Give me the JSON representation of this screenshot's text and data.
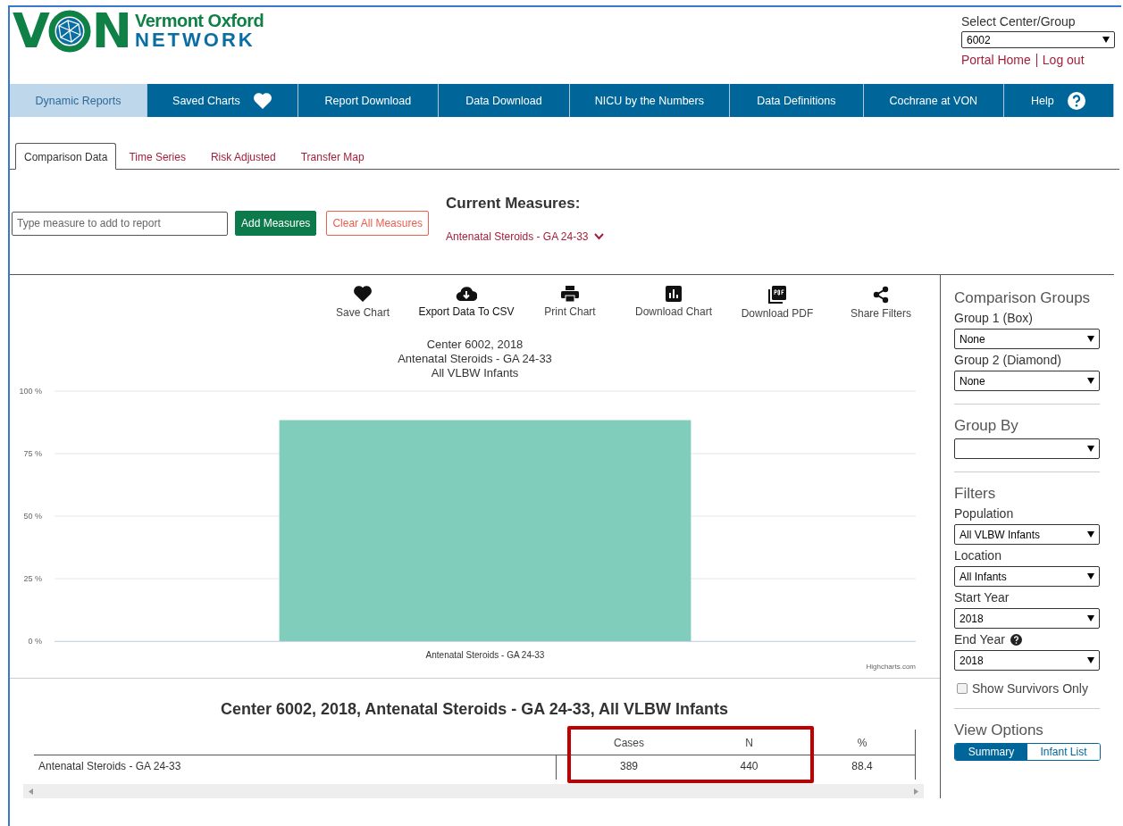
{
  "logo": {
    "letters_left": "V",
    "letters_right": "N",
    "line1": "Vermont Oxford",
    "line2": "NETWORK"
  },
  "center_select": {
    "label": "Select Center/Group",
    "value": "6002"
  },
  "header_links": [
    "Portal Home",
    "Log out"
  ],
  "nav": [
    {
      "label": "Dynamic Reports",
      "selected": true,
      "kind": "text"
    },
    {
      "label": "Saved Charts",
      "selected": false,
      "kind": "heart"
    },
    {
      "label": "Report Download",
      "selected": false,
      "kind": "text"
    },
    {
      "label": "Data Download",
      "selected": false,
      "kind": "text"
    },
    {
      "label": "NICU by the Numbers",
      "selected": false,
      "kind": "text"
    },
    {
      "label": "Data Definitions",
      "selected": false,
      "kind": "text"
    },
    {
      "label": "Cochrane at VON",
      "selected": false,
      "kind": "text"
    },
    {
      "label": "Help",
      "selected": false,
      "kind": "help"
    }
  ],
  "tabs": [
    {
      "label": "Comparison Data",
      "selected": true
    },
    {
      "label": "Time Series",
      "selected": false
    },
    {
      "label": "Risk Adjusted",
      "selected": false
    },
    {
      "label": "Transfer Map",
      "selected": false
    }
  ],
  "measure_search": {
    "placeholder": "Type measure to add to report"
  },
  "buttons": [
    {
      "label": "Add Measures",
      "kind": "primary"
    },
    {
      "label": "Clear All Measures",
      "kind": "danger"
    }
  ],
  "current_measures": {
    "heading": "Current Measures:",
    "items": [
      "Antenatal Steroids - GA 24-33"
    ]
  },
  "toolbar": [
    {
      "label": "Save Chart",
      "kind": "heart"
    },
    {
      "label": "Export Data To CSV",
      "kind": "cloud"
    },
    {
      "label": "Print Chart",
      "kind": "print"
    },
    {
      "label": "Download Chart",
      "kind": "chart"
    },
    {
      "label": "Download PDF",
      "kind": "pdf"
    },
    {
      "label": "Share Filters",
      "kind": "share"
    }
  ],
  "chart": {
    "credits": "Highcharts.com",
    "chart_data": {
      "type": "bar",
      "title": "Center 6002, 2018\nAntenatal Steroids - GA 24-33\nAll VLBW Infants",
      "categories": [
        "Antenatal Steroids - GA 24-33"
      ],
      "series": [
        {
          "color": "#80cdbc",
          "values": [
            88.4
          ]
        }
      ],
      "ylim": [
        0,
        100
      ],
      "grid": true,
      "yticks": [
        {
          "value": 0,
          "label": "0 %"
        },
        {
          "value": 25,
          "label": "25 %"
        },
        {
          "value": 50,
          "label": "50 %"
        },
        {
          "value": 75,
          "label": "75 %"
        },
        {
          "value": 100,
          "label": "100 %"
        }
      ]
    }
  },
  "table": {
    "title": "Center 6002, 2018, Antenatal Steroids - GA 24-33, All VLBW Infants",
    "columns": [
      {
        "label": "Cases",
        "highlighted": true
      },
      {
        "label": "N",
        "highlighted": true
      },
      {
        "label": "%",
        "highlighted": false
      }
    ],
    "rows": [
      {
        "label": "Antenatal Steroids - GA 24-33",
        "cells": [
          "389",
          "440",
          "88.4"
        ]
      }
    ]
  },
  "sidebar": {
    "sections": [
      {
        "heading": "Comparison Groups",
        "fields": [
          {
            "label": "Group 1 (Box)",
            "value": "None",
            "kind": "dropdown"
          },
          {
            "label": "Group 2 (Diamond)",
            "value": "None",
            "kind": "dropdown"
          }
        ]
      },
      {
        "heading": "Group By",
        "fields": [
          {
            "kind": "dropdown"
          }
        ]
      },
      {
        "heading": "Filters",
        "fields": [
          {
            "label": "Population",
            "value": "All VLBW Infants",
            "kind": "dropdown"
          },
          {
            "label": "Location",
            "value": "All Infants",
            "kind": "dropdown"
          },
          {
            "label": "Start Year",
            "value": "2018",
            "kind": "dropdown"
          },
          {
            "label": "End Year",
            "value": "2018",
            "help": true,
            "kind": "dropdown"
          }
        ],
        "checkbox": {
          "label": "Show Survivors Only",
          "checked": false
        }
      },
      {
        "heading": "View Options",
        "options": [
          {
            "label": "Summary",
            "selected": true
          },
          {
            "label": "Infant List",
            "selected": false
          }
        ]
      }
    ]
  }
}
